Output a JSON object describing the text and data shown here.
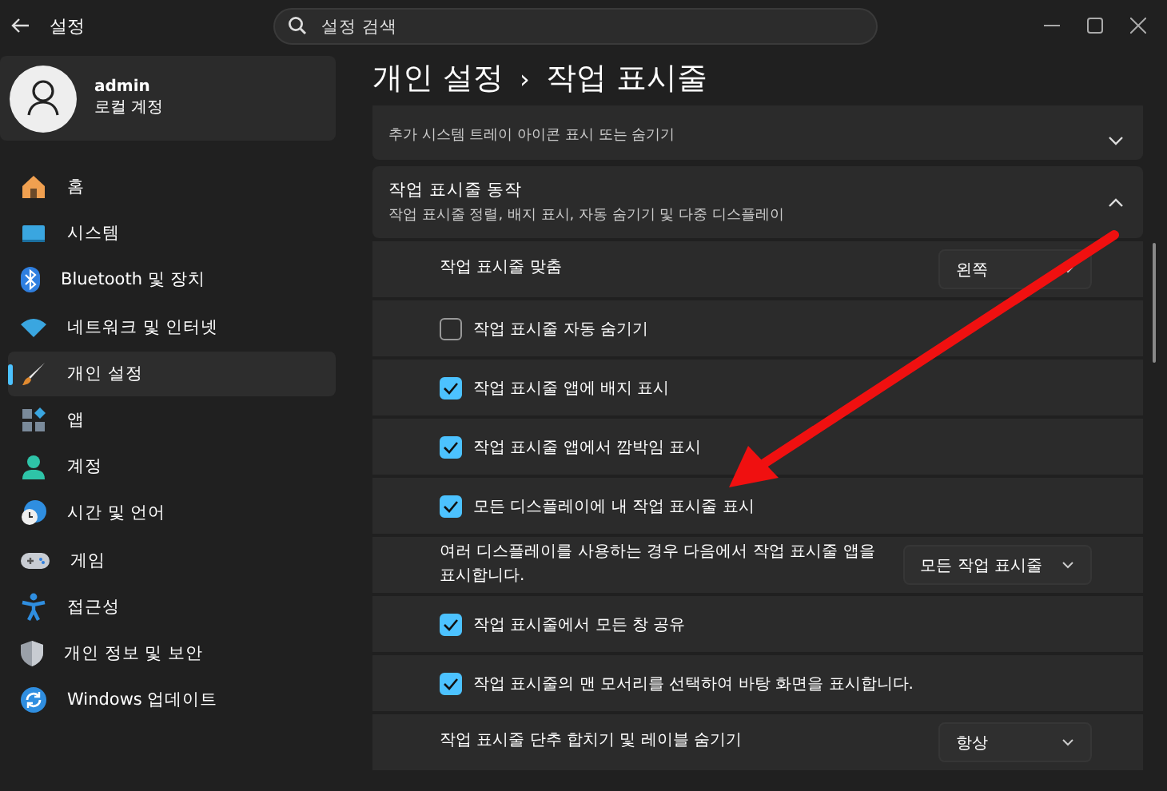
{
  "window": {
    "title": "설정"
  },
  "search": {
    "placeholder": "설정 검색"
  },
  "profile": {
    "name": "admin",
    "account": "로컬 계정"
  },
  "sidebar": {
    "items": [
      {
        "label": "홈",
        "selected": false
      },
      {
        "label": "시스템",
        "selected": false
      },
      {
        "label": "Bluetooth 및 장치",
        "selected": false
      },
      {
        "label": "네트워크 및 인터넷",
        "selected": false
      },
      {
        "label": "개인 설정",
        "selected": true
      },
      {
        "label": "앱",
        "selected": false
      },
      {
        "label": "계정",
        "selected": false
      },
      {
        "label": "시간 및 언어",
        "selected": false
      },
      {
        "label": "게임",
        "selected": false
      },
      {
        "label": "접근성",
        "selected": false
      },
      {
        "label": "개인 정보 및 보안",
        "selected": false
      },
      {
        "label": "Windows 업데이트",
        "selected": false
      }
    ]
  },
  "breadcrumb": {
    "parent": "개인 설정",
    "separator": "›",
    "current": "작업 표시줄"
  },
  "sections": [
    {
      "subtitle": "추가 시스템 트레이 아이콘 표시 또는 숨기기",
      "expanded": false
    },
    {
      "title": "작업 표시줄 동작",
      "subtitle": "작업 표시줄 정렬, 배지 표시, 자동 숨기기 및 다중 디스플레이",
      "expanded": true,
      "rows": [
        {
          "kind": "dropdown",
          "label": "작업 표시줄 맞춤",
          "value": "왼쪽"
        },
        {
          "kind": "checkbox",
          "label": "작업 표시줄 자동 숨기기",
          "checked": false
        },
        {
          "kind": "checkbox",
          "label": "작업 표시줄 앱에 배지 표시",
          "checked": true
        },
        {
          "kind": "checkbox",
          "label": "작업 표시줄 앱에서 깜박임 표시",
          "checked": true
        },
        {
          "kind": "checkbox",
          "label": "모든 디스플레이에 내 작업 표시줄 표시",
          "checked": true
        },
        {
          "kind": "dropdown",
          "label": "여러 디스플레이를 사용하는 경우 다음에서 작업 표시줄 앱을 표시합니다.",
          "value": "모든 작업 표시줄"
        },
        {
          "kind": "checkbox",
          "label": "작업 표시줄에서 모든 창 공유",
          "checked": true
        },
        {
          "kind": "checkbox",
          "label": "작업 표시줄의 맨 모서리를 선택하여 바탕 화면을 표시합니다.",
          "checked": true
        },
        {
          "kind": "dropdown",
          "label": "작업 표시줄 단추 합치기 및 레이블 숨기기",
          "value": "항상"
        }
      ]
    }
  ]
}
